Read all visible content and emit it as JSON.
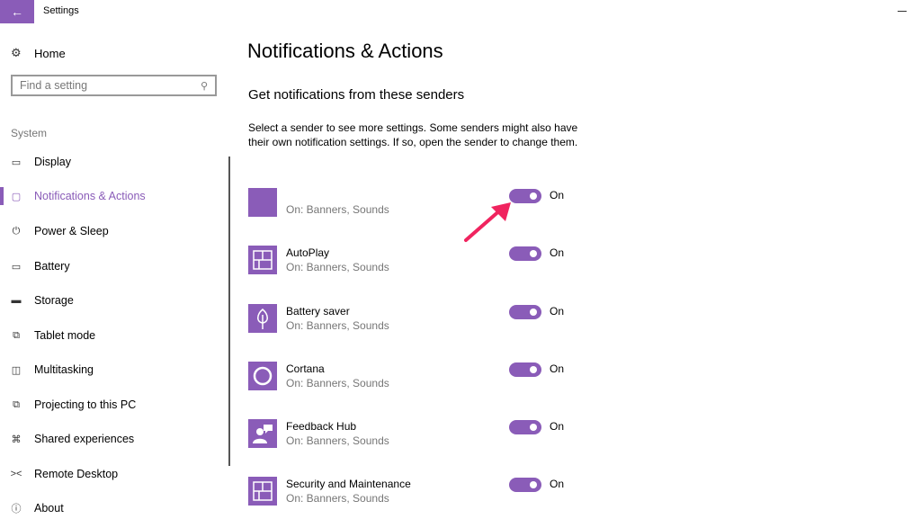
{
  "titlebar": {
    "title": "Settings",
    "back_icon": "←"
  },
  "sidebar": {
    "home_label": "Home",
    "search_placeholder": "Find a setting",
    "section_label": "System",
    "items": [
      {
        "label": "Display",
        "icon": "display-icon",
        "glyph": "▭"
      },
      {
        "label": "Notifications & Actions",
        "icon": "notifications-icon",
        "glyph": "▢",
        "active": true
      },
      {
        "label": "Power & Sleep",
        "icon": "power-icon",
        "glyph": "⏻"
      },
      {
        "label": "Battery",
        "icon": "battery-icon",
        "glyph": "▭"
      },
      {
        "label": "Storage",
        "icon": "storage-icon",
        "glyph": "▬"
      },
      {
        "label": "Tablet mode",
        "icon": "tablet-mode-icon",
        "glyph": "⧉"
      },
      {
        "label": "Multitasking",
        "icon": "multitasking-icon",
        "glyph": "◫"
      },
      {
        "label": "Projecting to this PC",
        "icon": "projecting-icon",
        "glyph": "⧉"
      },
      {
        "label": "Shared experiences",
        "icon": "shared-experiences-icon",
        "glyph": "⌘"
      },
      {
        "label": "Remote Desktop",
        "icon": "remote-desktop-icon",
        "glyph": "><"
      },
      {
        "label": "About",
        "icon": "about-icon",
        "glyph": "ⓘ"
      }
    ]
  },
  "main": {
    "title": "Notifications & Actions",
    "subtitle": "Get notifications from these senders",
    "description": "Select a sender to see more settings. Some senders might also have their own notification settings. If so, open the sender to change them.",
    "senders": [
      {
        "name": "",
        "status": "On: Banners, Sounds",
        "toggle": "On",
        "icon": "blank-app-icon"
      },
      {
        "name": "AutoPlay",
        "status": "On: Banners, Sounds",
        "toggle": "On",
        "icon": "autoplay-icon"
      },
      {
        "name": "Battery saver",
        "status": "On: Banners, Sounds",
        "toggle": "On",
        "icon": "battery-saver-icon"
      },
      {
        "name": "Cortana",
        "status": "On: Banners, Sounds",
        "toggle": "On",
        "icon": "cortana-icon"
      },
      {
        "name": "Feedback Hub",
        "status": "On: Banners, Sounds",
        "toggle": "On",
        "icon": "feedback-hub-icon"
      },
      {
        "name": "Security and Maintenance",
        "status": "On: Banners, Sounds",
        "toggle": "On",
        "icon": "security-maintenance-icon"
      }
    ]
  },
  "colors": {
    "accent": "#8a5cb8",
    "annotation_arrow": "#f0245f"
  }
}
